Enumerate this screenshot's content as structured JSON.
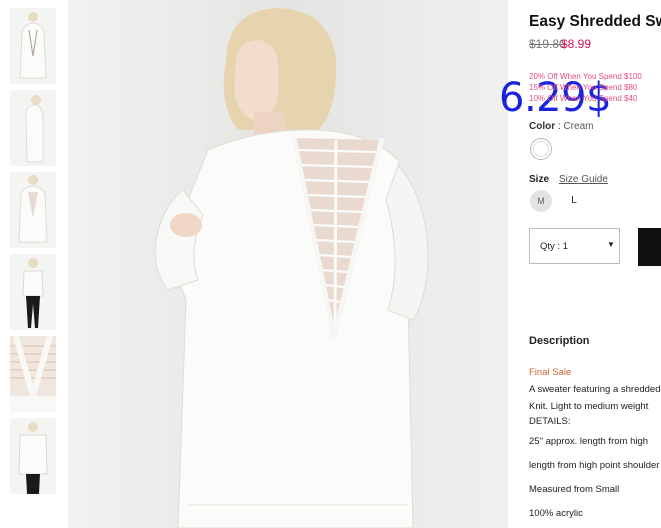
{
  "product": {
    "title": "Easy Shredded Sweater",
    "price_original": "$19.80",
    "price_sale": "$8.99",
    "overlay_price": "6.29$",
    "promos": [
      "20% Off When You Spend $100",
      "15% Off When You Spend $80",
      "10% Off When You Spend $40"
    ]
  },
  "options": {
    "color_label": "Color",
    "color_separator": ":",
    "color_value": "Cream",
    "swatch_color": "#ffffff",
    "size_label": "Size",
    "size_guide": "Size Guide",
    "sizes": [
      "M",
      "L"
    ],
    "selected_size": "M",
    "quantity_label": "Qty : 1"
  },
  "description": {
    "heading": "Description",
    "final_sale": "Final Sale",
    "lines": [
      "A sweater featuring a shredded",
      "Knit. Light to medium weight",
      "DETAILS:",
      "25\" approx. length from high",
      "length from high point shoulder",
      "Measured from Small",
      "100% acrylic"
    ]
  },
  "gallery": {
    "thumbnail_count": 6,
    "accent_colors": {
      "sale": "#d4145a",
      "promo": "#e64d7f",
      "overlay": "#1a22e0",
      "final_sale": "#c86530"
    }
  }
}
